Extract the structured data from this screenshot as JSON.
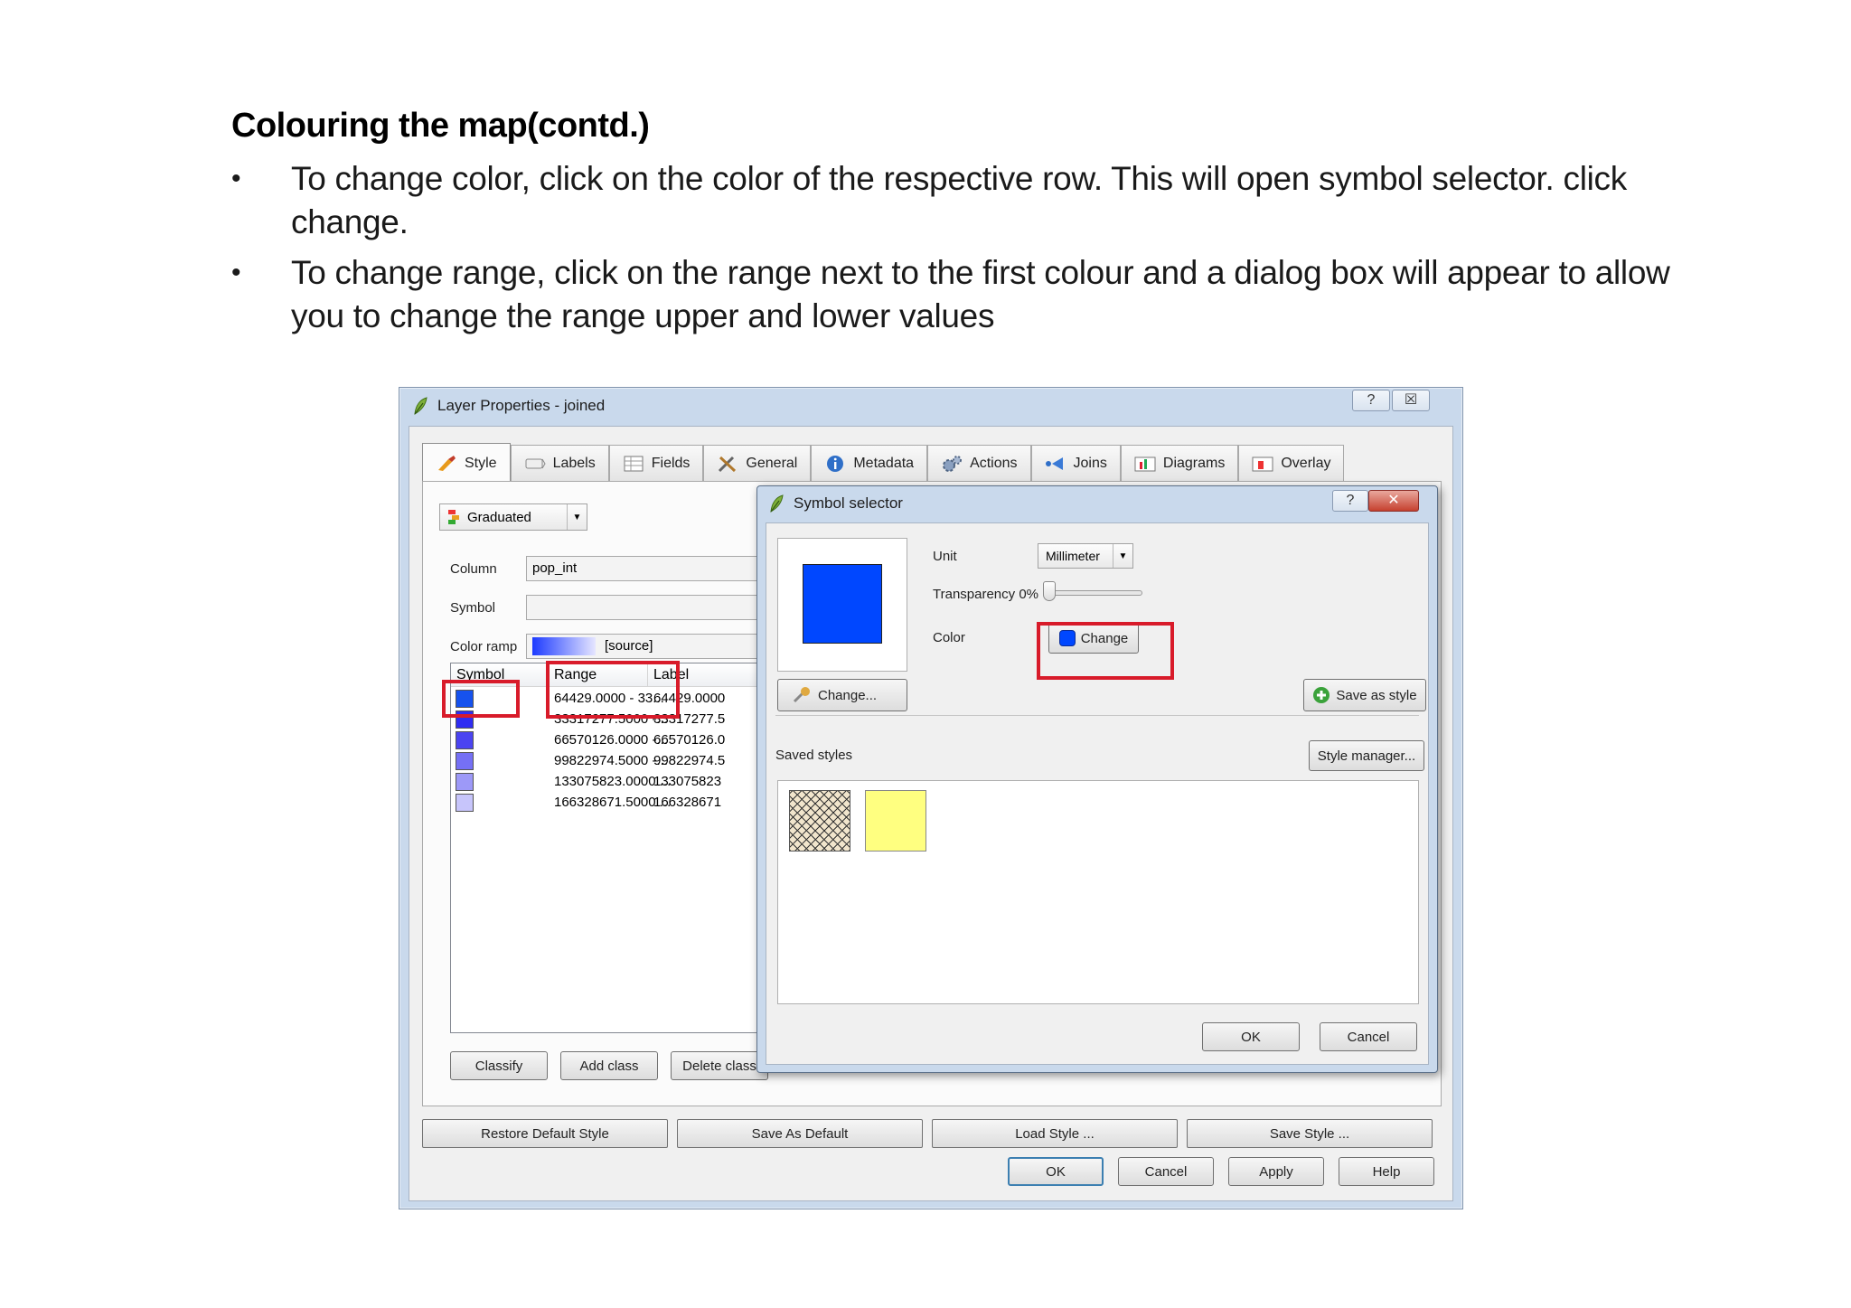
{
  "slide": {
    "title": "Colouring the map(contd.)",
    "bullets": [
      "To change color, click on the color of the respective row. This will open symbol selector. click change.",
      "To change range, click on the range next to the first colour and a dialog box will appear to allow you to change the range upper and lower values"
    ],
    "bullet_glyph": "•"
  },
  "window": {
    "title": "Layer Properties - joined",
    "help": "?",
    "close": "☒",
    "tabs": [
      {
        "label": "Style",
        "icon": "brush-icon"
      },
      {
        "label": "Labels",
        "icon": "label-icon"
      },
      {
        "label": "Fields",
        "icon": "table-icon"
      },
      {
        "label": "General",
        "icon": "tools-icon"
      },
      {
        "label": "Metadata",
        "icon": "info-icon"
      },
      {
        "label": "Actions",
        "icon": "gears-icon"
      },
      {
        "label": "Joins",
        "icon": "join-icon"
      },
      {
        "label": "Diagrams",
        "icon": "diagram-icon"
      },
      {
        "label": "Overlay",
        "icon": "overlay-icon"
      }
    ],
    "renderer": "Graduated",
    "column_label": "Column",
    "column_value": "pop_int",
    "symbol_label": "Symbol",
    "color_ramp_label": "Color ramp",
    "color_ramp_value": "[source]",
    "table": {
      "headers": [
        "Symbol",
        "Range",
        "Label"
      ],
      "rows": [
        {
          "color": "#1652ee",
          "range": "64429.0000 - 33...",
          "label": "64429.0000"
        },
        {
          "color": "#2f2cf2",
          "range": "33317277.5000 -...",
          "label": "33317277.5"
        },
        {
          "color": "#4b44f1",
          "range": "66570126.0000 -...",
          "label": "66570126.0"
        },
        {
          "color": "#7570f5",
          "range": "99822974.5000 -...",
          "label": "99822974.5"
        },
        {
          "color": "#9d99f8",
          "range": "133075823.0000 ...",
          "label": "133075823"
        },
        {
          "color": "#c7c5fb",
          "range": "166328671.5000 ...",
          "label": "166328671"
        }
      ]
    },
    "buttons": {
      "classify": "Classify",
      "add_class": "Add class",
      "delete_class": "Delete class",
      "restore_default": "Restore Default Style",
      "save_default": "Save As Default",
      "load_style": "Load Style ...",
      "save_style": "Save Style ...",
      "ok": "OK",
      "cancel": "Cancel",
      "apply": "Apply",
      "help": "Help"
    }
  },
  "symbol_selector": {
    "title": "Symbol selector",
    "help": "?",
    "close": "✕",
    "unit_label": "Unit",
    "unit_value": "Millimeter",
    "transparency_label": "Transparency 0%",
    "transparency_value": 0,
    "color_label": "Color",
    "color_value": "#0047ff",
    "change_color_button": "Change",
    "change_button": "Change...",
    "save_as_style": "Save as style",
    "saved_styles_label": "Saved styles",
    "style_manager": "Style manager...",
    "ok": "OK",
    "cancel": "Cancel"
  },
  "colors": {
    "highlight": "#d81b2a",
    "window_frame": "#c9d9ec"
  }
}
